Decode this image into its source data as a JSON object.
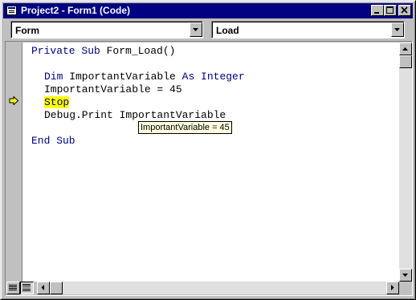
{
  "window": {
    "title": "Project2 - Form1 (Code)",
    "buttons": {
      "minimize": "minimize",
      "maximize": "maximize",
      "close": "close"
    }
  },
  "object_combo": {
    "value": "Form"
  },
  "procedure_combo": {
    "value": "Load"
  },
  "code": {
    "line1": {
      "keyword1": "Private Sub",
      "rest": " Form_Load()"
    },
    "line2": {
      "keyword1": "Dim",
      "mid": " ImportantVariable ",
      "keyword2": "As Integer"
    },
    "line3": {
      "text": "ImportantVariable = 45"
    },
    "line4": {
      "keyword": "Stop"
    },
    "line5": {
      "text": "Debug.Print ImportantVariable"
    },
    "line6": {
      "keyword": "End Sub"
    }
  },
  "tooltip": {
    "text": "ImportantVariable = 45"
  },
  "colors": {
    "keyword": "#000080",
    "highlight": "#ffff00",
    "titlebar": "#000080",
    "tooltip_bg": "#ffffe1"
  },
  "icons": {
    "app": "code-window-icon",
    "execution_arrow": "execution-point-arrow-icon",
    "procedure_view": "procedure-view-icon",
    "full_module_view": "full-module-view-icon"
  }
}
